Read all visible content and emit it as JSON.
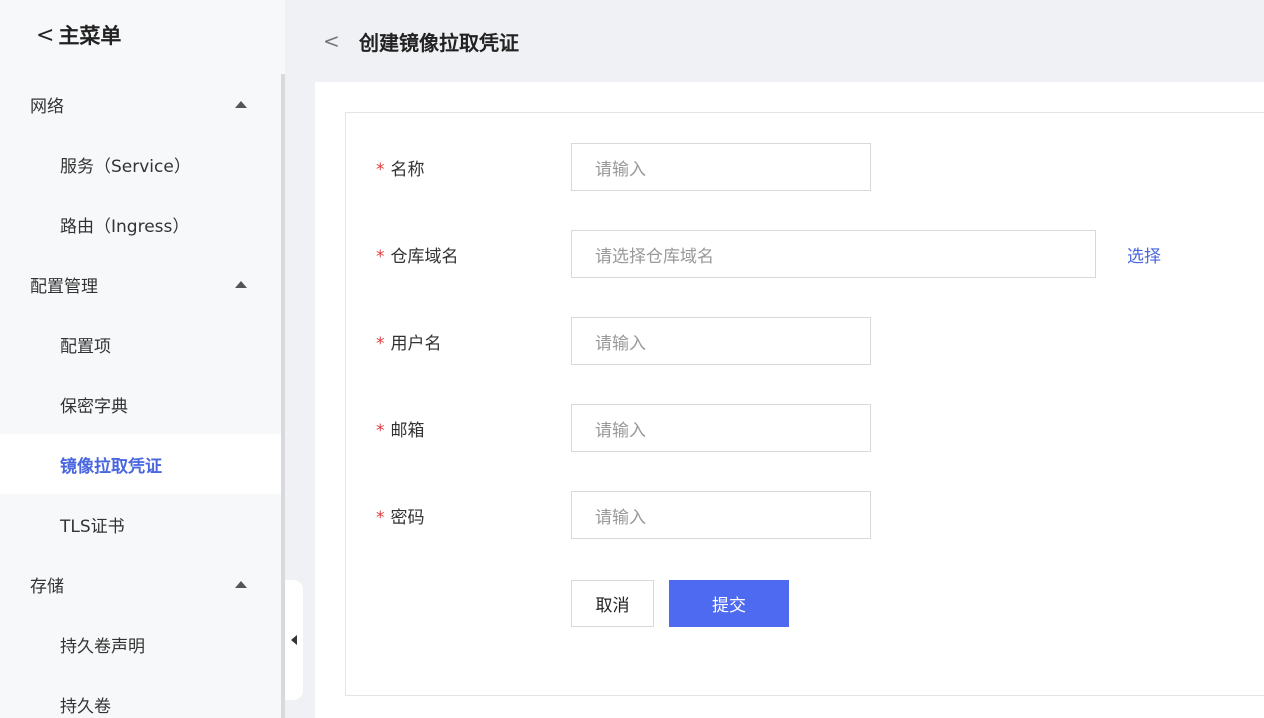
{
  "sidebar": {
    "back_glyph": "<",
    "title": "主菜单",
    "groups": [
      {
        "label": "网络",
        "items": [
          {
            "label": "服务（Service）"
          },
          {
            "label": "路由（Ingress）"
          }
        ]
      },
      {
        "label": "配置管理",
        "items": [
          {
            "label": "配置项"
          },
          {
            "label": "保密字典"
          },
          {
            "label": "镜像拉取凭证",
            "active": true
          },
          {
            "label": "TLS证书"
          }
        ]
      },
      {
        "label": "存储",
        "items": [
          {
            "label": "持久卷声明"
          },
          {
            "label": "持久卷"
          }
        ]
      }
    ]
  },
  "header": {
    "back_glyph": "<",
    "title": "创建镜像拉取凭证"
  },
  "form": {
    "required_mark": "*",
    "fields": [
      {
        "label": "名称",
        "placeholder": "请输入"
      },
      {
        "label": "仓库域名",
        "placeholder": "请选择仓库域名",
        "action": "选择"
      },
      {
        "label": "用户名",
        "placeholder": "请输入"
      },
      {
        "label": "邮箱",
        "placeholder": "请输入"
      },
      {
        "label": "密码",
        "placeholder": "请输入"
      }
    ],
    "cancel_label": "取消",
    "submit_label": "提交"
  },
  "colors": {
    "accent": "#4d6af0",
    "active_text": "#4a67e0",
    "required": "#e03a3a"
  },
  "icons": {
    "collapse_toggle": "caret-left-icon",
    "group_toggle": "caret-up-icon"
  }
}
